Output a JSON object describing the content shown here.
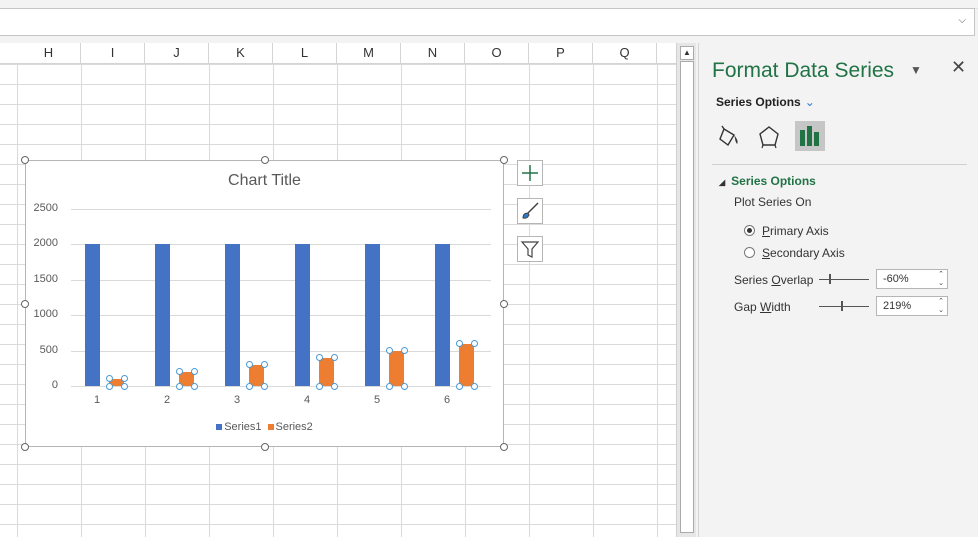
{
  "sheet": {
    "columns": [
      "H",
      "I",
      "J",
      "K",
      "L",
      "M",
      "N",
      "O",
      "P",
      "Q"
    ]
  },
  "chart": {
    "title_text": "Chart Title",
    "y_ticks": [
      "2500",
      "2000",
      "1500",
      "1000",
      "500",
      "0"
    ],
    "legend": [
      {
        "name": "Series1",
        "color": "#4472c4"
      },
      {
        "name": "Series2",
        "color": "#ed7d31"
      }
    ]
  },
  "chart_data": {
    "type": "bar",
    "title": "Chart Title",
    "categories": [
      "1",
      "2",
      "3",
      "4",
      "5",
      "6"
    ],
    "series": [
      {
        "name": "Series1",
        "values": [
          2000,
          2000,
          2000,
          2000,
          2000,
          2000
        ],
        "color": "#4472c4"
      },
      {
        "name": "Series2",
        "values": [
          100,
          200,
          300,
          400,
          500,
          600
        ],
        "color": "#ed7d31"
      }
    ],
    "ylim": [
      0,
      2500
    ],
    "grid": true,
    "legend_position": "bottom"
  },
  "pane": {
    "title": "Format Data Series",
    "dropdown_label": "Series Options",
    "section_title": "Series Options",
    "plot_on_label": "Plot Series On",
    "primary_pre": "P",
    "primary_rest": "rimary Axis",
    "secondary_pre": "S",
    "secondary_rest": "econdary Axis",
    "overlap_a": "Series ",
    "overlap_u": "O",
    "overlap_b": "verlap",
    "overlap_value": "-60%",
    "gap_a": "Gap ",
    "gap_u": "W",
    "gap_b": "idth",
    "gap_value": "219%",
    "selected_axis": "primary"
  }
}
